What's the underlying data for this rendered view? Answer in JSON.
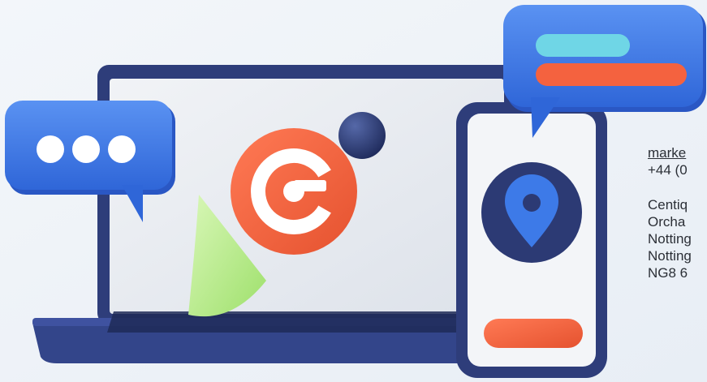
{
  "contact": {
    "email_fragment": "marke",
    "phone_fragment": "+44 (0",
    "address_lines": [
      "Centiq",
      "Orcha",
      "Notting",
      "Notting",
      "NG8 6"
    ]
  },
  "colors": {
    "background": "#eef3f8",
    "laptop_frame": "#2e3d7a",
    "screen": "#e6eaf0",
    "accent_orange": "#f4623f",
    "accent_blue": "#3d7ae8",
    "accent_cyan": "#6fd6e6",
    "cone_green": "#b5eb86",
    "navy": "#2c3a74"
  },
  "icons": [
    "chat-bubble-dots-icon",
    "at-sign-icon",
    "location-pin-icon",
    "message-bubble-icon",
    "cone-shape",
    "sphere-shape"
  ]
}
